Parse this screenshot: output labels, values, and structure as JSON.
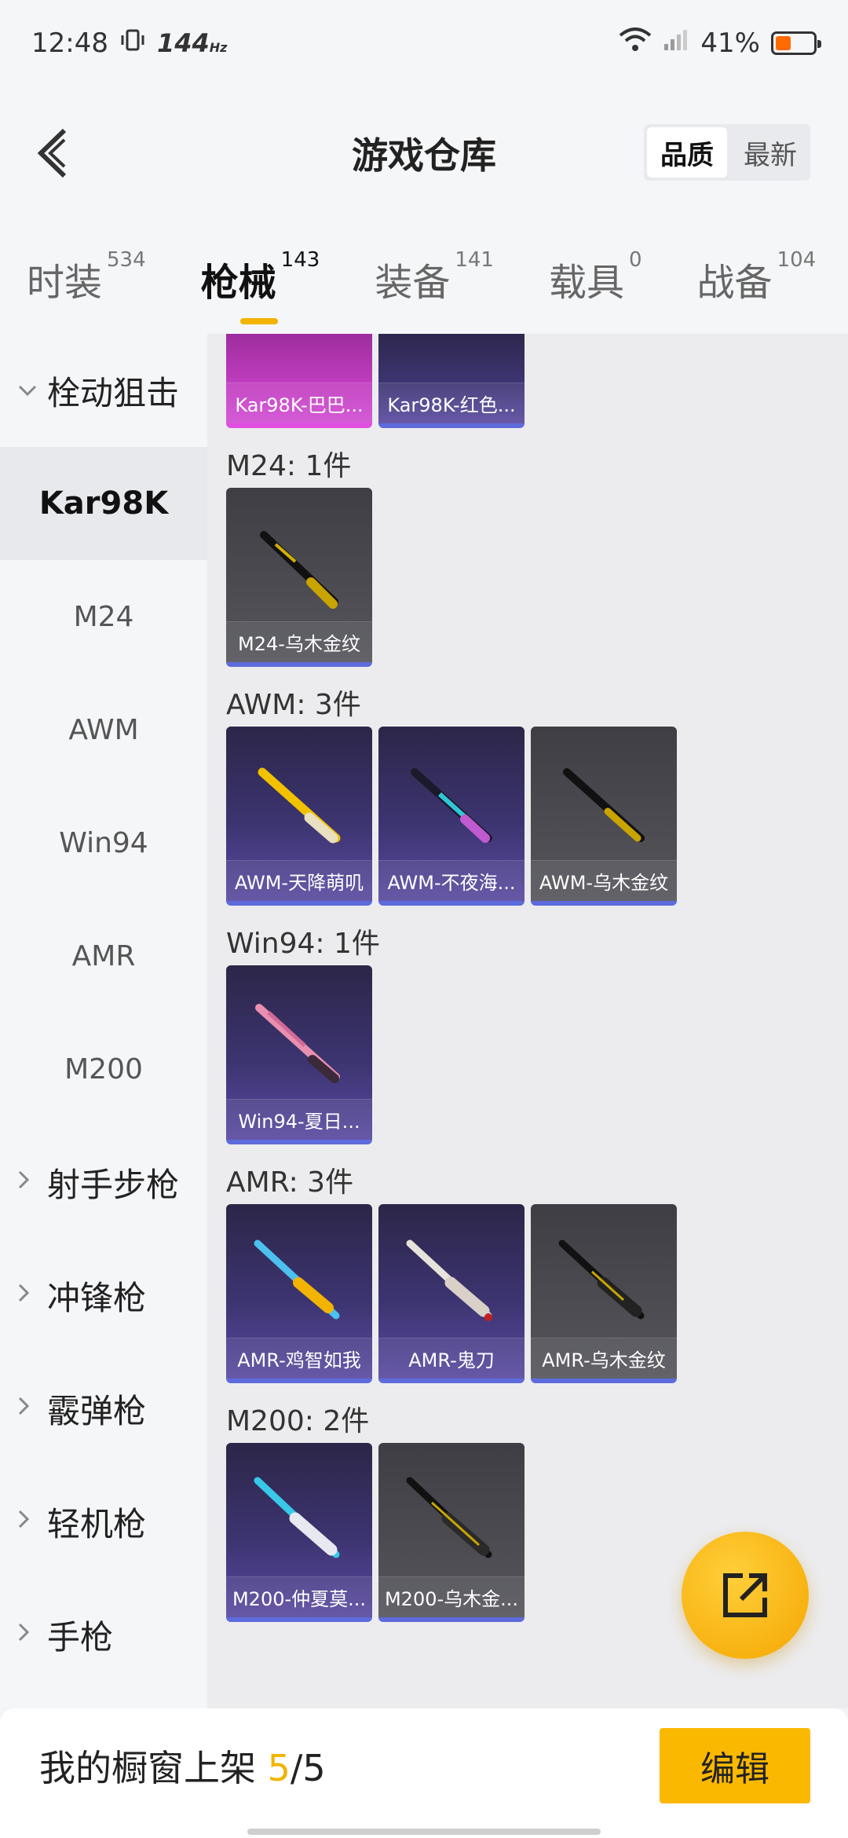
{
  "status_bar": {
    "time": "12:48",
    "refresh": "144",
    "refresh_unit": "Hz",
    "battery": "41%"
  },
  "header": {
    "title": "游戏仓库",
    "sort_options": [
      "品质",
      "最新"
    ],
    "active_sort": "品质"
  },
  "tabs": [
    {
      "label": "时装",
      "count": "534"
    },
    {
      "label": "枪械",
      "count": "143",
      "active": true
    },
    {
      "label": "装备",
      "count": "141"
    },
    {
      "label": "载具",
      "count": "0"
    },
    {
      "label": "战备",
      "count": "104"
    }
  ],
  "sidebar": {
    "open_category": "栓动狙击",
    "items": [
      "Kar98K",
      "M24",
      "AWM",
      "Win94",
      "AMR",
      "M200"
    ],
    "active_item": "Kar98K",
    "categories": [
      "射手步枪",
      "冲锋枪",
      "霰弹枪",
      "轻机枪",
      "手枪"
    ]
  },
  "groups": {
    "kar98k_partial": [
      "Kar98K-巴巴...",
      "Kar98K-红色..."
    ],
    "m24": {
      "title": "M24: 1件",
      "items": [
        "M24-乌木金纹"
      ]
    },
    "awm": {
      "title": "AWM: 3件",
      "items": [
        "AWM-天降萌叽",
        "AWM-不夜海...",
        "AWM-乌木金纹"
      ]
    },
    "win94": {
      "title": "Win94: 1件",
      "items": [
        "Win94-夏日..."
      ]
    },
    "amr": {
      "title": "AMR: 3件",
      "items": [
        "AMR-鸡智如我",
        "AMR-鬼刀",
        "AMR-乌木金纹"
      ]
    },
    "m200": {
      "title": "M200: 2件",
      "items": [
        "M200-仲夏莫...",
        "M200-乌木金..."
      ]
    }
  },
  "bottom_bar": {
    "label": "我的橱窗上架",
    "current": "5",
    "separator": "/",
    "total": "5",
    "edit_label": "编辑"
  },
  "colors": {
    "accent": "#f2b400",
    "card_purple": "#3c3470",
    "card_gray": "#4c4c52"
  },
  "icons": [
    "back-arrow-icon",
    "share-out-icon",
    "chevron-down-icon",
    "chevron-right-icon",
    "wifi-icon",
    "signal-icon",
    "vibrate-icon",
    "battery-icon"
  ]
}
